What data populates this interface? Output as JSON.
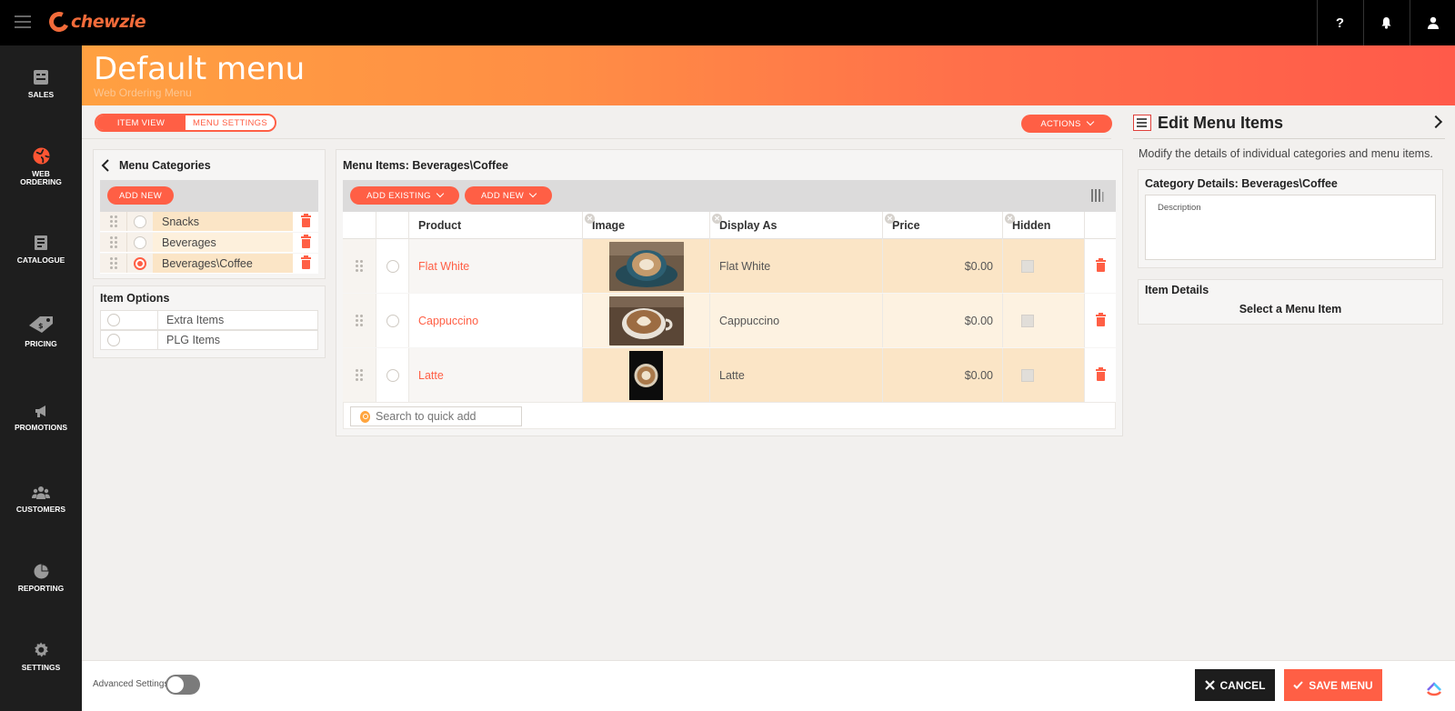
{
  "app": {
    "brand": "chewzie"
  },
  "topbar": {
    "help": "?",
    "bell": "bell-icon",
    "user": "user-icon"
  },
  "nav": [
    {
      "label": "SALES",
      "icon": "sales-icon"
    },
    {
      "label": "WEB ORDERING",
      "icon": "globe-icon",
      "active": true
    },
    {
      "label": "CATALOGUE",
      "icon": "catalogue-icon"
    },
    {
      "label": "PRICING",
      "icon": "price-tag-icon"
    },
    {
      "label": "PROMOTIONS",
      "icon": "megaphone-icon"
    },
    {
      "label": "CUSTOMERS",
      "icon": "customers-icon"
    },
    {
      "label": "REPORTING",
      "icon": "pie-chart-icon"
    },
    {
      "label": "SETTINGS",
      "icon": "gear-icon"
    }
  ],
  "header": {
    "title": "Default menu",
    "subtitle": "Web Ordering Menu"
  },
  "tabs": {
    "item_view": "ITEM VIEW",
    "menu_settings": "MENU SETTINGS"
  },
  "actions": {
    "label": "ACTIONS"
  },
  "categories": {
    "title": "Menu Categories",
    "add_new": "ADD NEW",
    "items": [
      "Snacks",
      "Beverages",
      "Beverages\\Coffee"
    ],
    "selected": "Beverages\\Coffee"
  },
  "item_options": {
    "title": "Item Options",
    "items": [
      "Extra Items",
      "PLG Items"
    ]
  },
  "menu_items": {
    "title": "Menu Items: Beverages\\Coffee",
    "add_existing": "ADD EXISTING",
    "add_new": "ADD NEW",
    "columns": {
      "product": "Product",
      "image": "Image",
      "display_as": "Display As",
      "price": "Price",
      "hidden": "Hidden"
    },
    "rows": [
      {
        "product": "Flat White",
        "display_as": "Flat White",
        "price": "$0.00",
        "image": "flat-white-photo"
      },
      {
        "product": "Cappuccino",
        "display_as": "Cappuccino",
        "price": "$0.00",
        "image": "cappuccino-photo"
      },
      {
        "product": "Latte",
        "display_as": "Latte",
        "price": "$0.00",
        "image": "latte-photo"
      }
    ],
    "quick_add_placeholder": "Search to quick add"
  },
  "edit_panel": {
    "title": "Edit Menu Items",
    "description": "Modify the details of individual categories and menu items.",
    "category_details": "Category Details: Beverages\\Coffee",
    "description_placeholder": "Description",
    "item_details": "Item Details",
    "select_prompt": "Select a Menu Item"
  },
  "footer": {
    "advanced": "Advanced Settings",
    "cancel": "CANCEL",
    "save": "SAVE MENU"
  },
  "colors": {
    "accent": "#ff5f45",
    "orange": "#ffa041",
    "row_highlight": "#fbe5c6"
  }
}
